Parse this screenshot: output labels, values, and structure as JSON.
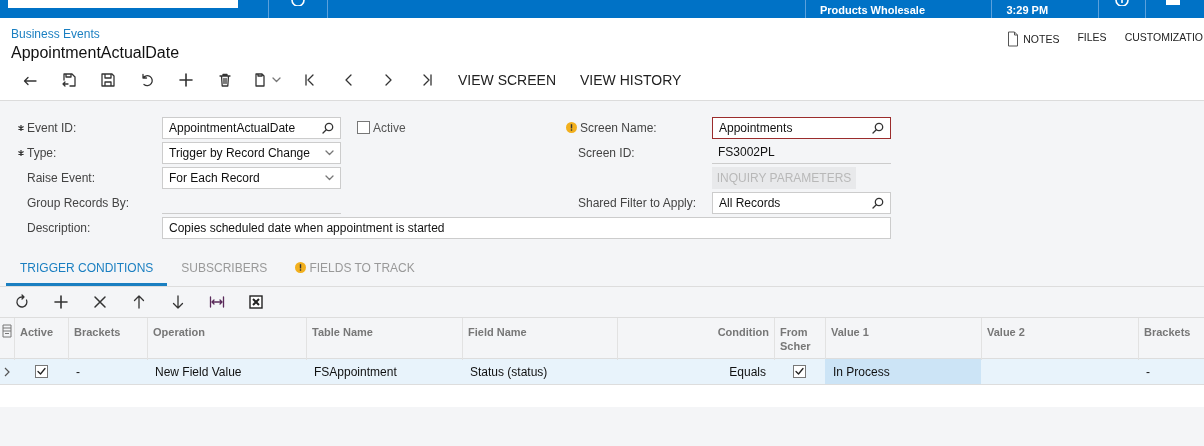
{
  "top_bar": {
    "company": "Products Wholesale",
    "time": "3:29 PM"
  },
  "header": {
    "breadcrumb": "Business Events",
    "title": "AppointmentActualDate",
    "actions": [
      {
        "label": "NOTES",
        "kind": "icon"
      },
      {
        "label": "FILES",
        "kind": "text"
      },
      {
        "label": "CUSTOMIZATIO",
        "kind": "text"
      }
    ]
  },
  "toolbar": {
    "text_buttons": [
      "VIEW SCREEN",
      "VIEW HISTORY"
    ]
  },
  "form": {
    "event_id": {
      "label": "Event ID:",
      "value": "AppointmentActualDate",
      "required": true
    },
    "active": {
      "label": "Active",
      "checked": false
    },
    "type": {
      "label": "Type:",
      "value": "Trigger by Record Change",
      "required": true
    },
    "raise_event": {
      "label": "Raise Event:",
      "value": "For Each Record"
    },
    "group_records_by": {
      "label": "Group Records By:"
    },
    "description": {
      "label": "Description:",
      "value": "Copies scheduled date when appointment is started"
    },
    "screen_name": {
      "label": "Screen Name:",
      "value": "Appointments",
      "warning": true,
      "error": true
    },
    "screen_id": {
      "label": "Screen ID:",
      "value": "FS3002PL"
    },
    "inquiry_parameters": {
      "label": "INQUIRY PARAMETERS",
      "disabled": true
    },
    "shared_filter": {
      "label": "Shared Filter to Apply:",
      "value": "All Records"
    }
  },
  "tabs": [
    {
      "label": "TRIGGER CONDITIONS",
      "selected": true,
      "warning": false
    },
    {
      "label": "SUBSCRIBERS",
      "selected": false,
      "warning": false
    },
    {
      "label": "FIELDS TO TRACK",
      "selected": false,
      "warning": true
    }
  ],
  "grid": {
    "columns": [
      {
        "label": "Active",
        "kind": "plain"
      },
      {
        "label": "Brackets",
        "kind": "plain"
      },
      {
        "label": "Operation",
        "kind": "plain"
      },
      {
        "label": "Table Name",
        "kind": "plain"
      },
      {
        "label": "Field Name",
        "kind": "plain"
      },
      {
        "label": "Condition",
        "kind": "right"
      },
      {
        "label": "From Scher",
        "kind": "plain"
      },
      {
        "label": "Value 1",
        "kind": "plain"
      },
      {
        "label": "Value 2",
        "kind": "plain"
      },
      {
        "label": "Brackets",
        "kind": "plain"
      }
    ],
    "rows": [
      {
        "cells": [
          {
            "kind": "check",
            "checked": true,
            "selected": false
          },
          {
            "kind": "text",
            "text": "-",
            "selected": false
          },
          {
            "kind": "text",
            "text": "New Field Value",
            "selected": false
          },
          {
            "kind": "text",
            "text": "FSAppointment",
            "selected": false
          },
          {
            "kind": "text",
            "text": "Status (status)",
            "selected": false
          },
          {
            "kind": "text",
            "text": "Equals",
            "selected": false
          },
          {
            "kind": "check",
            "checked": true,
            "selected": false
          },
          {
            "kind": "text",
            "text": "In Process",
            "selected": true
          },
          {
            "kind": "text",
            "selected": false
          },
          {
            "kind": "text",
            "text": "-",
            "selected": false
          }
        ]
      }
    ]
  }
}
